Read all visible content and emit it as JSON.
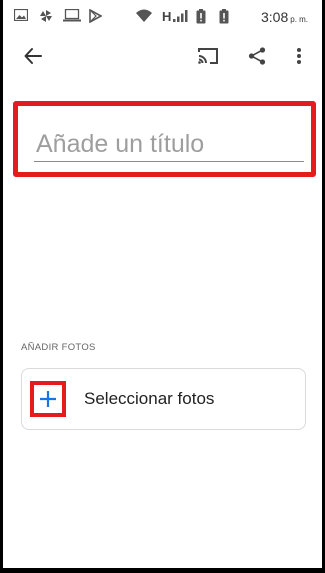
{
  "status_bar": {
    "time": "3:08",
    "ampm": "p. m.",
    "network": "H"
  },
  "toolbar": {
    "back_icon": "arrow-back-icon",
    "cast_icon": "cast-icon",
    "share_icon": "share-icon",
    "more_icon": "more-vert-icon"
  },
  "title_field": {
    "placeholder": "Añade un título",
    "value": ""
  },
  "add_photos": {
    "section_label": "AÑADIR FOTOS",
    "button_label": "Seleccionar fotos",
    "plus_icon": "plus-icon"
  },
  "colors": {
    "highlight": "#e41c1c",
    "accent": "#1a73e8"
  }
}
